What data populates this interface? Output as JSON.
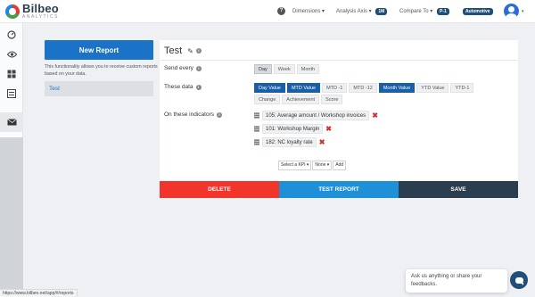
{
  "app": {
    "logo_name": "Bilbeo",
    "logo_sub": "ANALYTICS"
  },
  "topnav": {
    "dimensions": "Dimensions ▾",
    "analysis_axis": "Analysis Axis ▾",
    "analysis_axis_badge": "1M",
    "compare_to": "Compare To ▾",
    "compare_to_badge": "P-1",
    "automotive_badge": "Automotive",
    "user_caret": "▾"
  },
  "sidebar": {
    "items": [
      {
        "icon": "dashboard-gauge-icon"
      },
      {
        "icon": "eye-icon"
      },
      {
        "icon": "grid-icon"
      },
      {
        "icon": "list-icon"
      },
      {
        "icon": "envelope-icon"
      }
    ]
  },
  "left_panel": {
    "new_report_label": "New Report",
    "info_text": "This functionality allows you to receive custom reports based on your data.",
    "reports": [
      "Test"
    ]
  },
  "report": {
    "title": "Test",
    "send_every_label": "Send every",
    "send_every_options": [
      "Day",
      "Week",
      "Month"
    ],
    "send_every_selected": "Day",
    "these_data_label": "These data",
    "data_options": [
      {
        "label": "Day Value",
        "on": true
      },
      {
        "label": "MTD Value",
        "on": true
      },
      {
        "label": "MTD -1",
        "on": false
      },
      {
        "label": "MTD -12",
        "on": false
      },
      {
        "label": "Month Value",
        "on": true
      },
      {
        "label": "YTD Value",
        "on": false
      },
      {
        "label": "YTD-1",
        "on": false
      },
      {
        "label": "Change",
        "on": false
      },
      {
        "label": "Achievement",
        "on": false
      },
      {
        "label": "Score",
        "on": false
      }
    ],
    "indicators_label": "On these indicators",
    "indicators": [
      "105: Average amount / Workshop invoices",
      "101: Workshop Margin",
      "182: NC loyalty rate"
    ],
    "select_kpi": "Select a KPI ▾",
    "select_none": "None ▾",
    "add_label": "Add",
    "delete_label": "DELETE",
    "test_label": "TEST REPORT",
    "save_label": "SAVE"
  },
  "colors": {
    "delete": "#f2352b",
    "test": "#1e90d8",
    "save": "#2b3e50",
    "primary": "#1a73c7"
  },
  "chat": {
    "placeholder": "Ask us anything or share your feedbacks."
  },
  "status_url": "https://www.bilbeo.net/app/#/reports"
}
